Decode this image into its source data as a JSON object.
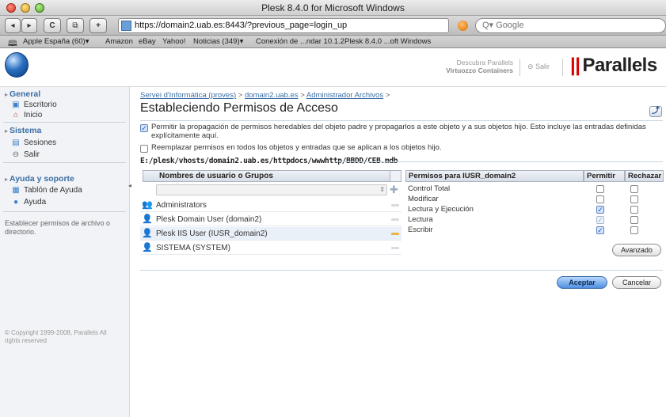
{
  "window": {
    "title": "Plesk 8.4.0 for Microsoft Windows"
  },
  "toolbar": {
    "back": "◂",
    "forward": "▸",
    "reload": "C",
    "snapback": "⧉",
    "add_bookmark": "+",
    "url": "https://domain2.uab.es:8443/?previous_page=login_up",
    "search_placeholder": "Q▾ Google"
  },
  "bookmarks": [
    "Apple España (60)▾",
    "Amazon",
    "eBay",
    "Yahoo!",
    "Noticias (349)▾",
    "Conexión de ...ndar 10.1.2",
    "Plesk 8.4.0 ...oft Windows"
  ],
  "header": {
    "promo_line1": "Descubra Parallels",
    "promo_line2": "Virtuozzo Containers",
    "salir": "Salir",
    "brand": "Parallels"
  },
  "sidebar": {
    "general": {
      "heading": "General",
      "items": [
        "Escritorio",
        "Inicio"
      ]
    },
    "sistema": {
      "heading": "Sistema",
      "items": [
        "Sesiones",
        "Salir"
      ]
    },
    "ayuda": {
      "heading": "Ayuda y soporte",
      "items": [
        "Tablón de Ayuda",
        "Ayuda"
      ]
    },
    "description": "Establecer permisos de archivo o directorio.",
    "copyright": "© Copyright 1999-2008, Parallels All rights reserved"
  },
  "breadcrumb": {
    "items": [
      "Servei d'Informàtica (proves)",
      "domain2.uab.es",
      "Administrador Archivos"
    ],
    "sep": ">"
  },
  "page": {
    "title": "Estableciendo Permisos de Acceso",
    "up_label": "⤴",
    "propagate_text_1": "Permitir la propagación de permisos heredables del objeto padre y propagarlos a este objeto y a sus objetos hijo. Esto incluye las entradas definidas",
    "propagate_text_2": "explícitamente aquí.",
    "replace_text": "Reemplazar permisos en todos los objetos y entradas que se aplican a los objetos hijo.",
    "path": "E:/plesk/vhosts/domain2.uab.es/httpdocs/wwwhttp/BBDD/CEB.mdb"
  },
  "users": {
    "header": "Nombres de usuario o Grupos",
    "rows": [
      {
        "name": "Administrators",
        "selected": false
      },
      {
        "name": "Plesk Domain User (domain2)",
        "selected": false
      },
      {
        "name": "Plesk IIS User (IUSR_domain2)",
        "selected": true
      },
      {
        "name": "SISTEMA (SYSTEM)",
        "selected": false
      }
    ]
  },
  "permissions": {
    "header": "Permisos para IUSR_domain2",
    "allow_header": "Permitir",
    "deny_header": "Rechazar",
    "rows": [
      {
        "label": "Control Total",
        "allow": false,
        "deny": false
      },
      {
        "label": "Modificar",
        "allow": false,
        "deny": false
      },
      {
        "label": "Lectura y Ejecución",
        "allow": true,
        "deny": false
      },
      {
        "label": "Lectura",
        "allow": true,
        "deny": false
      },
      {
        "label": "Escribir",
        "allow": true,
        "deny": false
      }
    ],
    "advanced_button": "Avanzado"
  },
  "actions": {
    "ok": "Aceptar",
    "cancel": "Cancelar"
  }
}
